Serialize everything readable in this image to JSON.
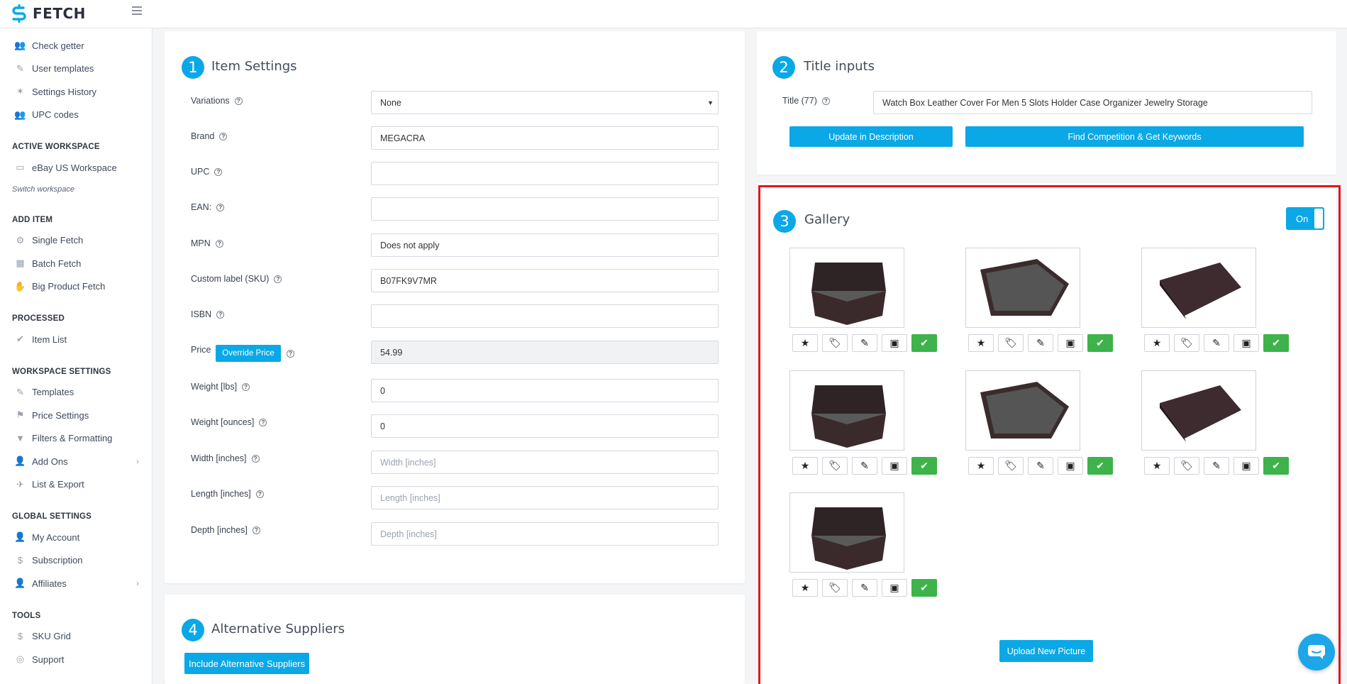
{
  "app": {
    "logo_text": "FETCH"
  },
  "sidebar": {
    "top_items": [
      {
        "label": "Check getter",
        "icon": "users-icon"
      },
      {
        "label": "User templates",
        "icon": "brush-icon"
      },
      {
        "label": "Settings History",
        "icon": "magic-icon"
      },
      {
        "label": "UPC codes",
        "icon": "users-icon"
      }
    ],
    "active_workspace_heading": "ACTIVE WORKSPACE",
    "workspace_item": "eBay US Workspace",
    "switch_workspace": "Switch workspace",
    "add_item_heading": "ADD ITEM",
    "add_item_items": [
      "Single Fetch",
      "Batch Fetch",
      "Big Product Fetch"
    ],
    "processed_heading": "PROCESSED",
    "processed_items": [
      "Item List"
    ],
    "workspace_settings_heading": "WORKSPACE SETTINGS",
    "workspace_settings_items": [
      "Templates",
      "Price Settings",
      "Filters & Formatting",
      "Add Ons",
      "List & Export"
    ],
    "global_settings_heading": "GLOBAL SETTINGS",
    "global_settings_items": [
      "My Account",
      "Subscription",
      "Affiliates"
    ],
    "tools_heading": "TOOLS",
    "tools_items": [
      "SKU Grid",
      "Support"
    ]
  },
  "item_settings": {
    "step": "1",
    "title": "Item Settings",
    "fields": {
      "variations": {
        "label": "Variations",
        "value": "None"
      },
      "brand": {
        "label": "Brand",
        "value": "MEGACRA"
      },
      "upc": {
        "label": "UPC",
        "value": ""
      },
      "ean": {
        "label": "EAN:",
        "value": ""
      },
      "mpn": {
        "label": "MPN",
        "value": "Does not apply"
      },
      "sku": {
        "label": "Custom label (SKU)",
        "value": "B07FK9V7MR"
      },
      "isbn": {
        "label": "ISBN",
        "value": ""
      },
      "price": {
        "label": "Price",
        "override_button": "Override Price",
        "value": "54.99"
      },
      "weight_lbs": {
        "label": "Weight [lbs]",
        "value": "0"
      },
      "weight_oz": {
        "label": "Weight [ounces]",
        "value": "0"
      },
      "width": {
        "label": "Width [inches]",
        "placeholder": "Width [inches]"
      },
      "length": {
        "label": "Length [inches]",
        "placeholder": "Length [inches]"
      },
      "depth": {
        "label": "Depth [inches]",
        "placeholder": "Depth [inches]"
      }
    }
  },
  "title_inputs": {
    "step": "2",
    "title": "Title inputs",
    "title_label": "Title (77)",
    "title_value": "Watch Box Leather Cover For Men 5 Slots Holder Case Organizer Jewelry Storage",
    "update_button": "Update in Description",
    "competition_button": "Find Competition & Get Keywords"
  },
  "gallery": {
    "step": "3",
    "title": "Gallery",
    "toggle_label": "On",
    "image_count": 7,
    "upload_button": "Upload New Picture"
  },
  "alternative_suppliers": {
    "step": "4",
    "title": "Alternative Suppliers",
    "include_button": "Include Alternative Suppliers"
  },
  "colors": {
    "accent": "#0aa8e6",
    "success": "#3db34a",
    "highlight": "#e0161e"
  }
}
